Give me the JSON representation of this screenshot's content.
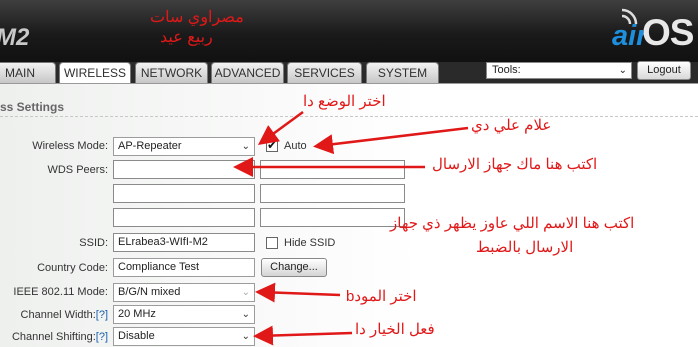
{
  "brand": {
    "model_suffix": "M2",
    "logo_air": "air",
    "logo_os": "OS"
  },
  "watermark": {
    "line1": "مصراوي سات",
    "line2": "ربيع عيد"
  },
  "tabs": [
    {
      "label": "MAIN",
      "active": false
    },
    {
      "label": "WIRELESS",
      "active": true
    },
    {
      "label": "NETWORK",
      "active": false
    },
    {
      "label": "ADVANCED",
      "active": false
    },
    {
      "label": "SERVICES",
      "active": false
    },
    {
      "label": "SYSTEM",
      "active": false
    }
  ],
  "tools": {
    "value": "Tools:"
  },
  "logout_label": "Logout",
  "section_title": "ss Settings",
  "form": {
    "wireless_mode": {
      "label": "Wireless Mode:",
      "value": "AP-Repeater",
      "auto_label": "Auto",
      "auto_checked": true
    },
    "wds_peers": {
      "label": "WDS Peers:",
      "values": [
        "",
        "",
        "",
        "",
        "",
        ""
      ]
    },
    "ssid": {
      "label": "SSID:",
      "value": "ELrabea3-WIfI-M2",
      "hide_label": "Hide SSID",
      "hide_checked": false
    },
    "country_code": {
      "label": "Country Code:",
      "value": "Compliance Test",
      "change_label": "Change..."
    },
    "ieee_mode": {
      "label": "IEEE 802.11 Mode:",
      "value": "B/G/N mixed"
    },
    "channel_width": {
      "label": "Channel Width:",
      "help": "[?]",
      "value": "20 MHz"
    },
    "channel_shifting": {
      "label": "Channel Shifting:",
      "help": "[?]",
      "value": "Disable"
    }
  },
  "annotations": {
    "choose_mode": "اختر الوضع دا",
    "tick_this": "علام علي دي",
    "mac_here": "اكتب هنا ماك جهاز الارسال",
    "ssid_line1": "اكتب هنا الاسم اللي عاوز يظهر ذي جهاز",
    "ssid_line2": "الارسال بالضبط",
    "choose_b_mode": "اختر المودb",
    "enable_option": "فعل الخيار دا"
  },
  "colors": {
    "annotation": "#e11818",
    "logo_air": "#1e8fdc",
    "header_bg": "#1a1a1a"
  }
}
